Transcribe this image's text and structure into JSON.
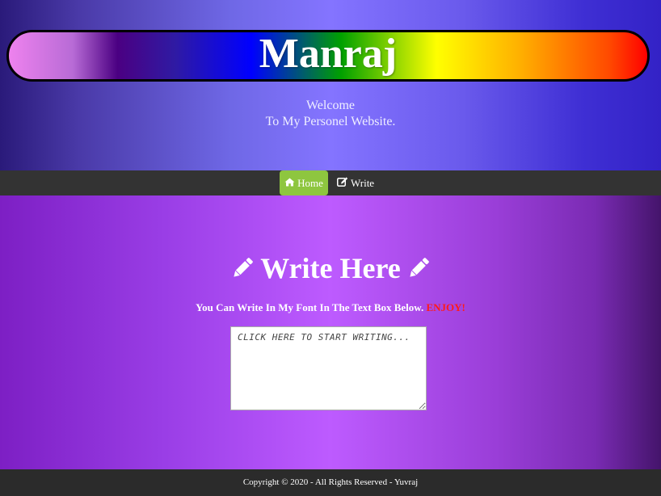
{
  "header": {
    "site_title": "Manraj",
    "welcome_line1": "Welcome",
    "welcome_line2": "To My Personel Website."
  },
  "nav": {
    "items": [
      {
        "label": "Home",
        "icon": "home-icon",
        "active": true,
        "active_color": "#8ec63f"
      },
      {
        "label": "Write",
        "icon": "edit-icon",
        "active": false
      }
    ]
  },
  "main": {
    "heading": "Write Here",
    "heading_icon": "pencil-icon",
    "subtitle": "You Can Write In My Font In The Text Box Below.",
    "subtitle_highlight": "ENJOY!",
    "highlight_color": "#ff1a1a",
    "textbox_placeholder": "CLICK HERE TO START WRITING..."
  },
  "footer": {
    "text": "Copyright © 2020 - All Rights Reserved - Yuvraj"
  }
}
